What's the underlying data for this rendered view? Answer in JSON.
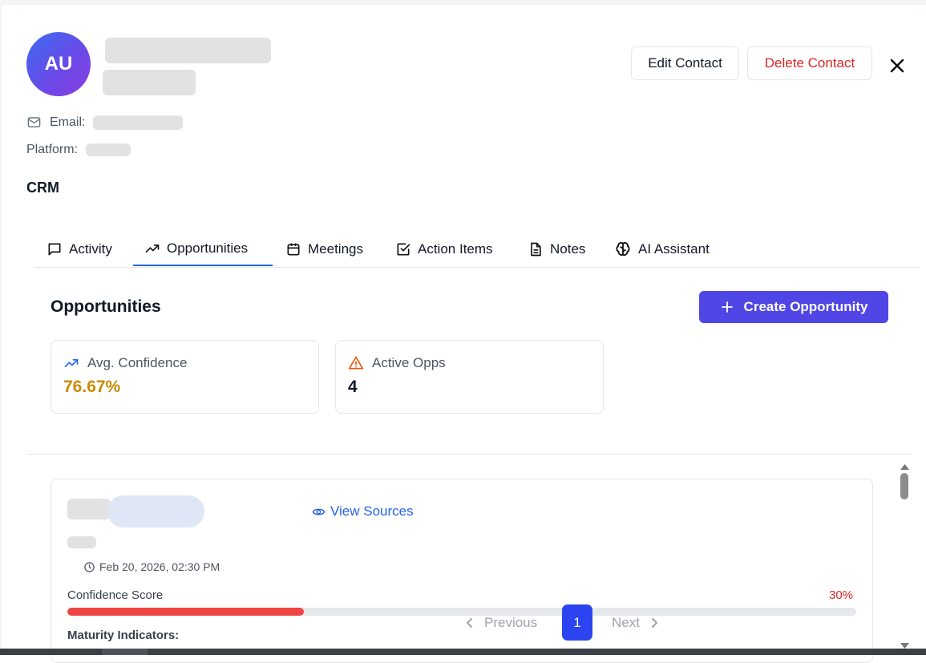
{
  "contact": {
    "initials": "AU",
    "email_label": "Email:",
    "platform_label": "Platform:",
    "section": "CRM"
  },
  "header": {
    "edit_label": "Edit Contact",
    "delete_label": "Delete Contact",
    "close_icon": "close-icon"
  },
  "tabs": [
    {
      "label": "Activity",
      "icon": "message-square-icon"
    },
    {
      "label": "Opportunities",
      "icon": "trending-up-icon",
      "active": true
    },
    {
      "label": "Meetings",
      "icon": "calendar-icon"
    },
    {
      "label": "Action Items",
      "icon": "check-square-icon"
    },
    {
      "label": "Notes",
      "icon": "file-text-icon"
    },
    {
      "label": "AI Assistant",
      "icon": "brain-icon"
    }
  ],
  "opportunities": {
    "title": "Opportunities",
    "create_label": "Create Opportunity",
    "stats": [
      {
        "label": "Avg. Confidence",
        "value": "76.67%",
        "icon": "trending-up-icon",
        "color": "#ca8a04"
      },
      {
        "label": "Active Opps",
        "value": "4",
        "icon": "alert-triangle-icon",
        "color": "#111827"
      }
    ]
  },
  "opportunity_card": {
    "view_sources_label": "View Sources",
    "date": "Feb 20, 2026, 02:30 PM",
    "confidence_label": "Confidence Score",
    "confidence_value": "30%",
    "confidence_fraction": 0.3,
    "maturity_label": "Maturity Indicators:"
  },
  "pagination": {
    "previous_label": "Previous",
    "current_page": "1",
    "next_label": "Next"
  },
  "colors": {
    "accent": "#4f46e5",
    "tab_active": "#2563eb",
    "danger": "#dc2626",
    "link": "#2563eb",
    "confidence_bar": "#ef4444",
    "page_active": "#2b44f0"
  }
}
